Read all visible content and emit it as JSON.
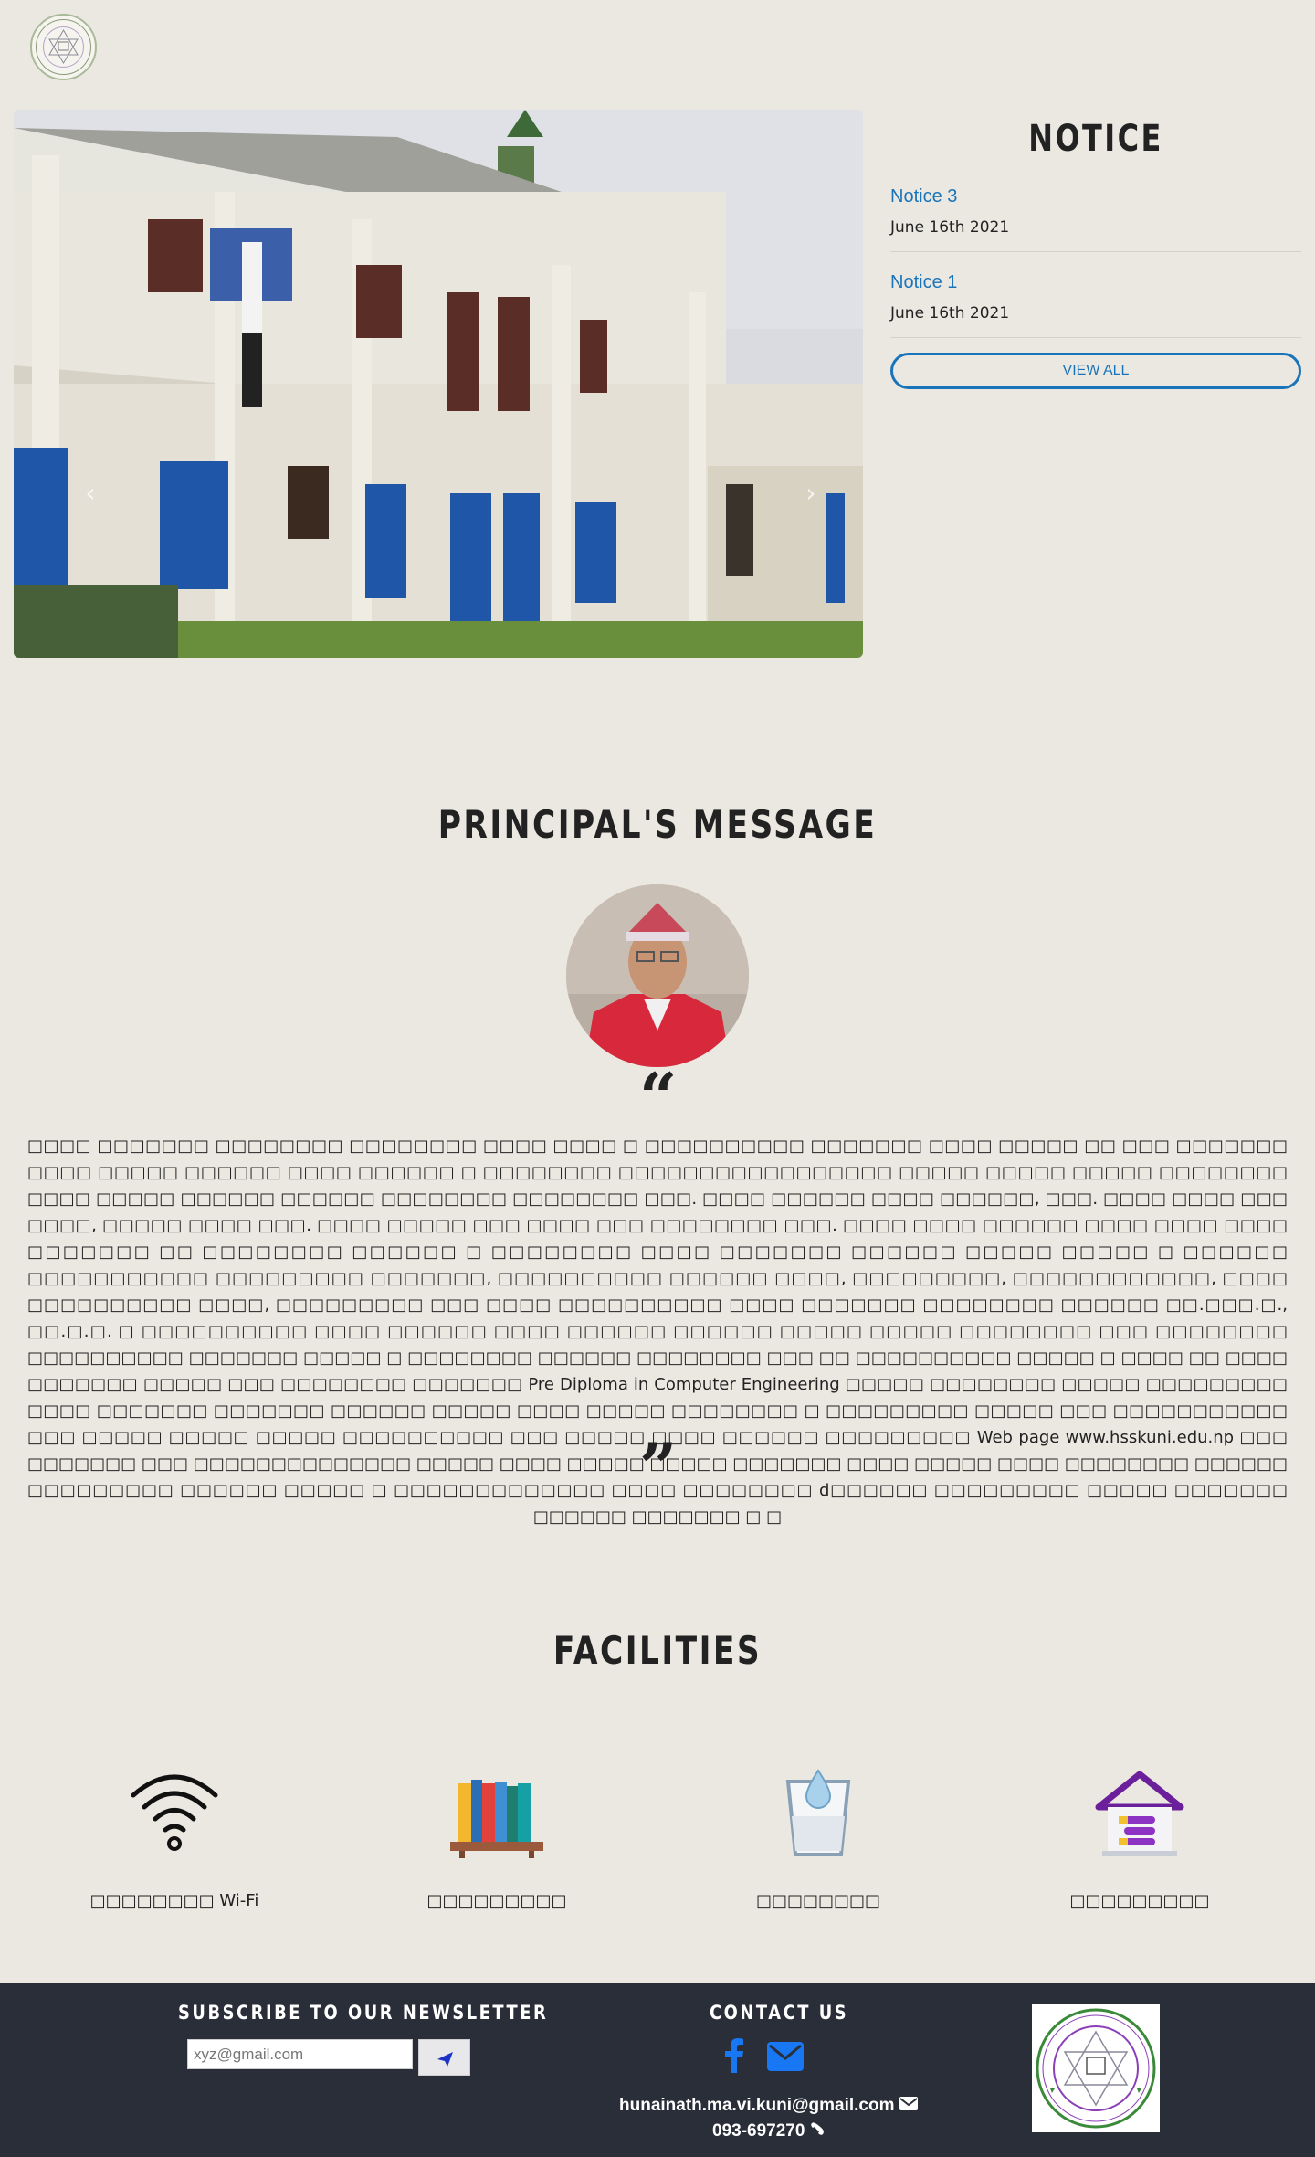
{
  "header": {
    "logo_icon": "school-seal-logo"
  },
  "carousel": {
    "prev_icon": "chevron-left-icon",
    "next_icon": "chevron-right-icon",
    "prev_glyph": "‹",
    "next_glyph": "›"
  },
  "notice": {
    "title": "NOTICE",
    "items": [
      {
        "title": "Notice 3",
        "date": "June 16th 2021"
      },
      {
        "title": "Notice 1",
        "date": "June 16th 2021"
      }
    ],
    "view_all_label": "VIEW ALL",
    "accent_color": "#1a74b9"
  },
  "principal": {
    "heading": "PRINCIPAL'S MESSAGE",
    "quote_open": "“",
    "quote_close": "”",
    "message": "□□□□ □□□□□□□ □□□□□□□□ □□□□□□□□ □□□□ □□□□ □ □□□□□□□□□□ □□□□□□□ □□□□ □□□□□ □□ □□□ □□□□□□□ □□□□ □□□□□ □□□□□□ □□□□ □□□□□□ □ □□□□□□□□ □□□□□□□□□□□□□□□□□ □□□□□ □□□□□ □□□□□ □□□□□□□□ □□□□ □□□□□ □□□□□□ □□□□□□ □□□□□□□□ □□□□□□□□ □□□. □□□□ □□□□□□ □□□□ □□□□□□, □□□. □□□□ □□□□ □□□ □□□□, □□□□□ □□□□ □□□. □□□□ □□□□□ □□□ □□□□ □□□ □□□□□□□□ □□□. □□□□ □□□□ □□□□□□ □□□□ □□□□ □□□□ □□□□□□□ □□ □□□□□□□□ □□□□□□ □ □□□□□□□□ □□□□ □□□□□□□ □□□□□□ □□□□□ □□□□□ □ □□□□□□ □□□□□□□□□□□ □□□□□□□□□ □□□□□□□, □□□□□□□□□□ □□□□□□ □□□□, □□□□□□□□□, □□□□□□□□□□□□, □□□□ □□□□□□□□□□ □□□□, □□□□□□□□□ □□□ □□□□ □□□□□□□□□□ □□□□ □□□□□□□ □□□□□□□□ □□□□□□ □□.□□□.□., □□.□.□. □ □□□□□□□□□□ □□□□ □□□□□□ □□□□ □□□□□□ □□□□□□ □□□□□ □□□□□ □□□□□□□□ □□□ □□□□□□□□ □□□□□□□□□□ □□□□□□□ □□□□□ □ □□□□□□□□ □□□□□□ □□□□□□□□ □□□ □□ □□□□□□□□□□ □□□□□ □ □□□□ □□ □□□□ □□□□□□□ □□□□□ □□□ □□□□□□□□ □□□□□□□ Pre Diploma in Computer Engineering □□□□□ □□□□□□□□ □□□□□ □□□□□□□□□ □□□□ □□□□□□□ □□□□□□□ □□□□□□ □□□□□ □□□□ □□□□□ □□□□□□□□ □ □□□□□□□□□ □□□□□ □□□ □□□□□□□□□□□ □□□ □□□□□ □□□□□ □□□□□ □□□□□□□□□□ □□□ □□□□□ □□□□ □□□□□□ □□□□□□□□□ Web page www.hsskuni.edu.np □□□ □□□□□□□ □□□ □□□□□□□□□□□□□□ □□□□□ □□□□ □□□□□ □□□□□ □□□□□□□ □□□□ □□□□□ □□□□ □□□□□□□□ □□□□□□ □□□□□□□□□ □□□□□□ □□□□□ □ □□□□□□□□□□□□□ □□□□ □□□□□□□□ d□□□□□□ □□□□□□□□□ □□□□□ □□□□□□□ □□□□□□ □□□□□□□ □ □"
  },
  "facilities": {
    "heading": "FACILITIES",
    "items": [
      {
        "label": "□□□□□□□□ Wi-Fi",
        "icon": "wifi-icon"
      },
      {
        "label": "□□□□□□□□□",
        "icon": "library-books-icon"
      },
      {
        "label": "□□□□□□□□",
        "icon": "drinking-water-icon"
      },
      {
        "label": "□□□□□□□□□",
        "icon": "hostel-house-icon"
      }
    ]
  },
  "footer": {
    "newsletter_heading": "SUBSCRIBE TO OUR NEWSLETTER",
    "newsletter_placeholder": "xyz@gmail.com",
    "send_icon": "paper-plane-icon",
    "contact_heading": "CONTACT US",
    "facebook_icon": "facebook-icon",
    "mail_icon": "envelope-icon",
    "email": "hunainath.ma.vi.kuni@gmail.com",
    "phone": "093-697270",
    "logo_icon": "school-seal-logo",
    "background_color": "#2a2e38"
  }
}
